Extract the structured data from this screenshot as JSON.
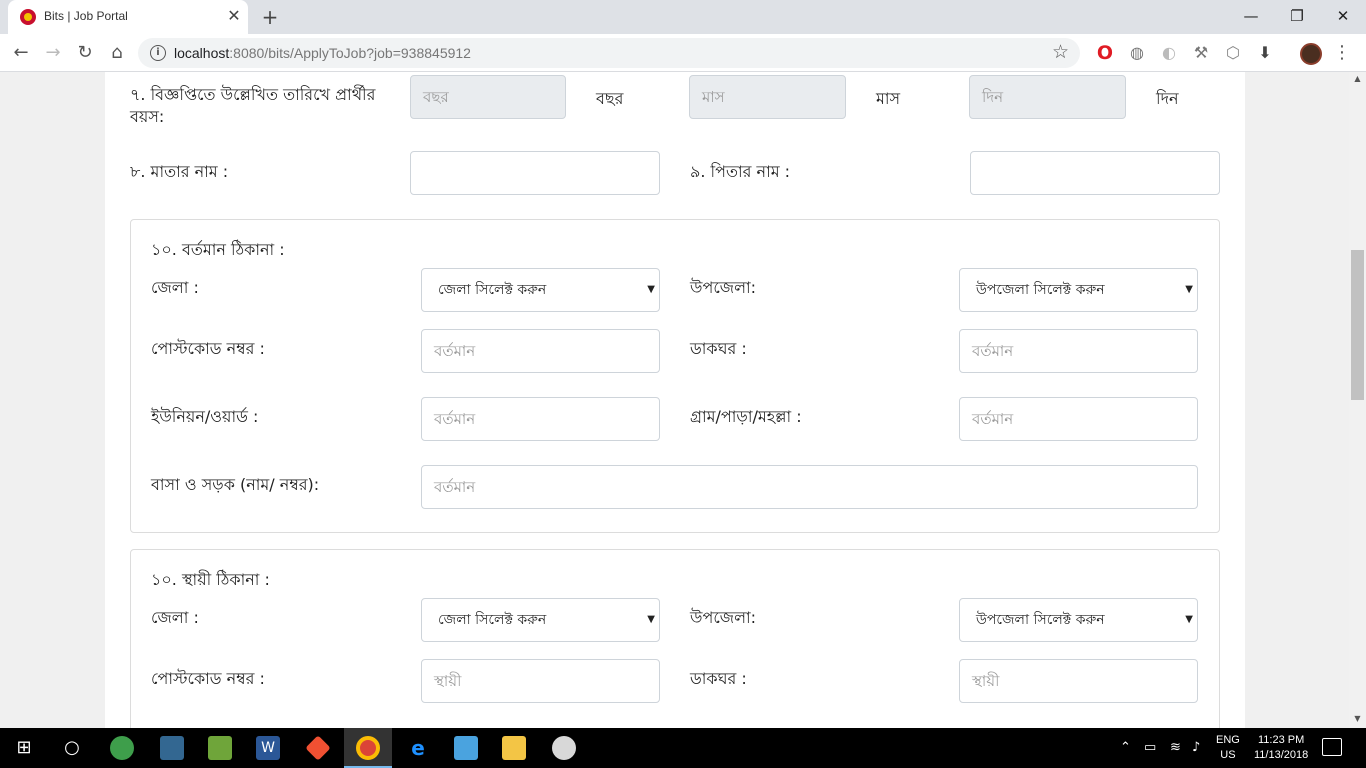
{
  "browser": {
    "tab_title": "Bits | Job Portal",
    "tab_close": "✕",
    "new_tab": "+",
    "url_host": "localhost",
    "url_rest": ":8080/bits/ApplyToJob?job=938845912",
    "window_controls": {
      "minimize": "—",
      "maximize": "❐",
      "close": "✕"
    }
  },
  "form": {
    "age": {
      "label": "৭. বিজ্ঞপ্তিতে উল্লেখিত তারিখে প্রার্থীর বয়স:",
      "year_placeholder": "বছর",
      "year_unit": "বছর",
      "month_placeholder": "মাস",
      "month_unit": "মাস",
      "day_placeholder": "দিন",
      "day_unit": "দিন"
    },
    "mother_name_label": "৮. মাতার নাম :",
    "father_name_label": "৯. পিতার নাম :",
    "present_address": {
      "title": "১০. বর্তমান ঠিকানা :",
      "district_label": "জেলা :",
      "district_select": "জেলা সিলেক্ট করুন",
      "upazila_label": "উপজেলা:",
      "upazila_select": "উপজেলা সিলেক্ট করুন",
      "postcode_label": "পোস্টকোড নম্বর :",
      "postcode_placeholder": "বর্তমান",
      "post_office_label": "ডাকঘর :",
      "post_office_placeholder": "বর্তমান",
      "union_label": "ইউনিয়ন/ওয়ার্ড :",
      "union_placeholder": "বর্তমান",
      "village_label": "গ্রাম/পাড়া/মহল্লা :",
      "village_placeholder": "বর্তমান",
      "house_road_label": "বাসা ও সড়ক (নাম/ নম্বর):",
      "house_road_placeholder": "বর্তমান"
    },
    "permanent_address": {
      "title": "১০. স্থায়ী ঠিকানা :",
      "district_label": "জেলা :",
      "district_select": "জেলা সিলেক্ট করুন",
      "upazila_label": "উপজেলা:",
      "upazila_select": "উপজেলা সিলেক্ট করুন",
      "postcode_label": "পোস্টকোড নম্বর :",
      "postcode_placeholder": "স্থায়ী",
      "post_office_label": "ডাকঘর :",
      "post_office_placeholder": "স্থায়ী"
    }
  },
  "taskbar": {
    "lang_line1": "ENG",
    "lang_line2": "US",
    "time": "11:23 PM",
    "date": "11/13/2018"
  },
  "colors": {
    "brand_red": "#c8102e",
    "taskbar_bg": "#000000",
    "input_border": "#ced4da",
    "disabled_bg": "#e9ecef"
  }
}
